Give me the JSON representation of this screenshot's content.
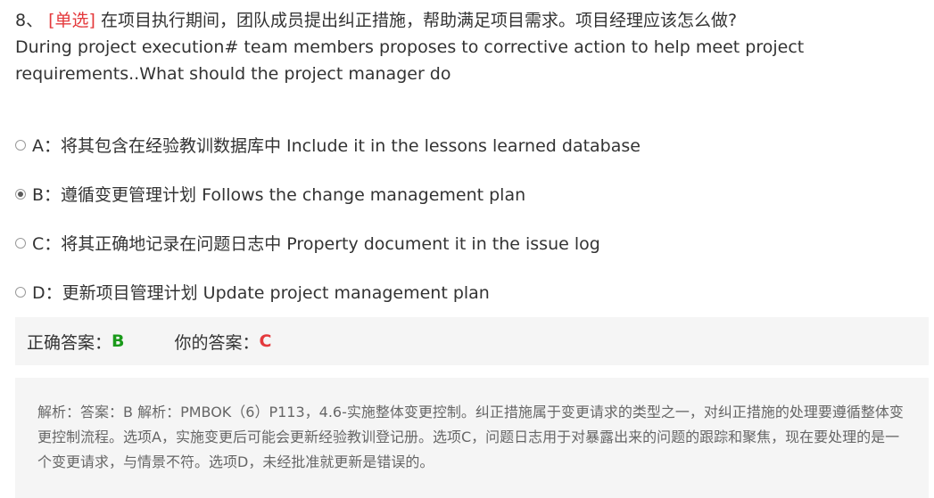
{
  "question": {
    "number": "8、",
    "type_tag": "[单选]",
    "text_cn": "在项目执行期间，团队成员提出纠正措施，帮助满足项目需求。项目经理应该怎么做?",
    "text_en": "During project execution# team members proposes to corrective action to help meet project requirements..What should the project manager do"
  },
  "options": [
    {
      "label": "A：将其包含在经验教训数据库中 Include it in the lessons learned database",
      "selected": false
    },
    {
      "label": "B：遵循变更管理计划 Follows the change management plan",
      "selected": true
    },
    {
      "label": "C：将其正确地记录在问题日志中 Property document it in the issue log",
      "selected": false
    },
    {
      "label": "D：更新项目管理计划 Update project management plan",
      "selected": false
    }
  ],
  "answers": {
    "correct_label": "正确答案：",
    "correct_value": "B",
    "yours_label": "你的答案：",
    "yours_value": "C",
    "correct_color": "#1a9a1a",
    "wrong_color": "#e4393c"
  },
  "explanation": {
    "text": "解析：答案：B 解析：PMBOK（6）P113，4.6-实施整体变更控制。纠正措施属于变更请求的类型之一，对纠正措施的处理要遵循整体变更控制流程。选项A，实施变更后可能会更新经验教训登记册。选项C，问题日志用于对暴露出来的问题的跟踪和聚焦，现在要处理的是一个变更请求，与情景不符。选项D，未经批准就更新是错误的。"
  }
}
